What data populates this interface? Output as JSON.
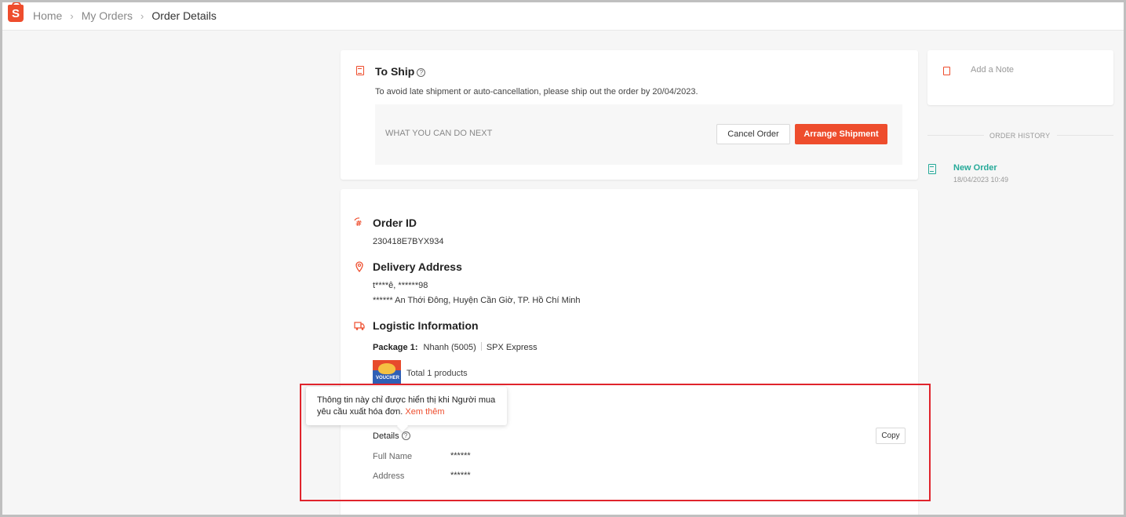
{
  "breadcrumb": {
    "logo": "S",
    "items": [
      "Home",
      "My Orders",
      "Order Details"
    ]
  },
  "status": {
    "title": "To Ship",
    "description": "To avoid late shipment or auto-cancellation, please ship out the order by 20/04/2023.",
    "next_label": "WHAT YOU CAN DO NEXT",
    "cancel_label": "Cancel Order",
    "arrange_label": "Arrange Shipment"
  },
  "order": {
    "id_title": "Order ID",
    "id_value": "230418E7BYX934",
    "address_title": "Delivery Address",
    "address_line1": "t****ê, ******98",
    "address_line2": "****** An Thới Đông, Huyện Cần Giờ, TP. Hồ Chí Minh",
    "logistic_title": "Logistic Information",
    "package_label": "Package 1:",
    "package_service": "Nhanh (5005)",
    "package_carrier": "SPX Express",
    "product_thumb_text": "VOUCHER",
    "products_total": "Total 1 products"
  },
  "invoice": {
    "tooltip_text": "Thông tin này chỉ được hiển thị khi Người mua yêu cầu xuất hóa đơn.",
    "tooltip_link": "Xem thêm",
    "details_label": "Details",
    "copy_label": "Copy",
    "full_name_label": "Full Name",
    "full_name_value": "******",
    "address_label": "Address",
    "address_value": "******"
  },
  "sidebar": {
    "note_label": "Add a Note",
    "history_heading": "ORDER HISTORY",
    "history": [
      {
        "title": "New Order",
        "time": "18/04/2023 10:49"
      }
    ]
  },
  "colors": {
    "accent": "#ee4d2d",
    "history_green": "#26aa99",
    "highlight_red": "#e0242c"
  }
}
